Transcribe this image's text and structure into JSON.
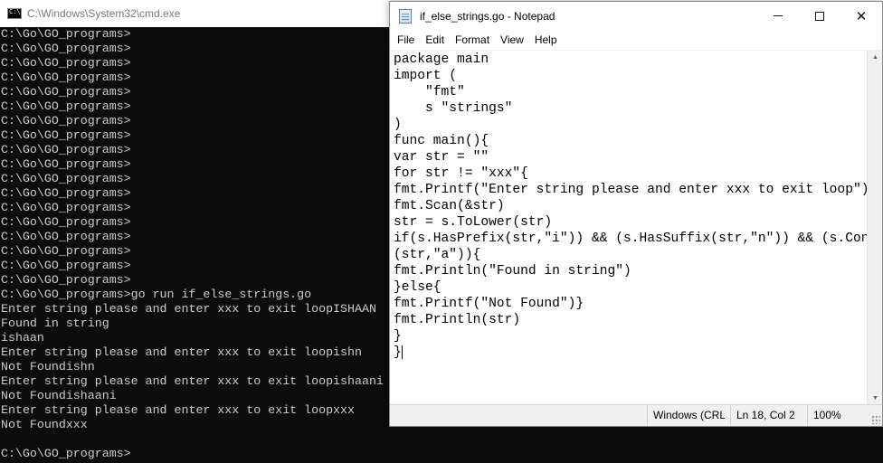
{
  "cmd": {
    "title": "C:\\Windows\\System32\\cmd.exe",
    "lines": [
      "C:\\Go\\GO_programs>",
      "C:\\Go\\GO_programs>",
      "C:\\Go\\GO_programs>",
      "C:\\Go\\GO_programs>",
      "C:\\Go\\GO_programs>",
      "C:\\Go\\GO_programs>",
      "C:\\Go\\GO_programs>",
      "C:\\Go\\GO_programs>",
      "C:\\Go\\GO_programs>",
      "C:\\Go\\GO_programs>",
      "C:\\Go\\GO_programs>",
      "C:\\Go\\GO_programs>",
      "C:\\Go\\GO_programs>",
      "C:\\Go\\GO_programs>",
      "C:\\Go\\GO_programs>",
      "C:\\Go\\GO_programs>",
      "C:\\Go\\GO_programs>",
      "C:\\Go\\GO_programs>",
      "C:\\Go\\GO_programs>go run if_else_strings.go",
      "Enter string please and enter xxx to exit loopISHAAN",
      "Found in string",
      "ishaan",
      "Enter string please and enter xxx to exit loopishn",
      "Not Foundishn",
      "Enter string please and enter xxx to exit loopishaani",
      "Not Foundishaani",
      "Enter string please and enter xxx to exit loopxxx",
      "Not Foundxxx",
      "",
      "C:\\Go\\GO_programs>"
    ]
  },
  "notepad": {
    "title": "if_else_strings.go - Notepad",
    "menu": [
      "File",
      "Edit",
      "Format",
      "View",
      "Help"
    ],
    "lines": [
      "package main",
      "import (",
      "    \"fmt\"",
      "    s \"strings\"",
      ")",
      "func main(){",
      "var str = \"\"",
      "for str != \"xxx\"{",
      "fmt.Printf(\"Enter string please and enter xxx to exit loop\")",
      "fmt.Scan(&str)",
      "str = s.ToLower(str)",
      "if(s.HasPrefix(str,\"i\")) && (s.HasSuffix(str,\"n\")) && (s.Contains",
      "(str,\"a\")){",
      "fmt.Println(\"Found in string\")",
      "}else{",
      "fmt.Printf(\"Not Found\")}",
      "fmt.Println(str)",
      "}",
      "}"
    ],
    "status": {
      "encoding": "Windows (CRL",
      "position": "Ln 18, Col 2",
      "zoom": "100%"
    }
  },
  "colors": {
    "console_bg": "#0c0c0c",
    "console_text": "#cccccc",
    "notepad_bg": "#ffffff",
    "statusbar_bg": "#f0f0f0"
  }
}
